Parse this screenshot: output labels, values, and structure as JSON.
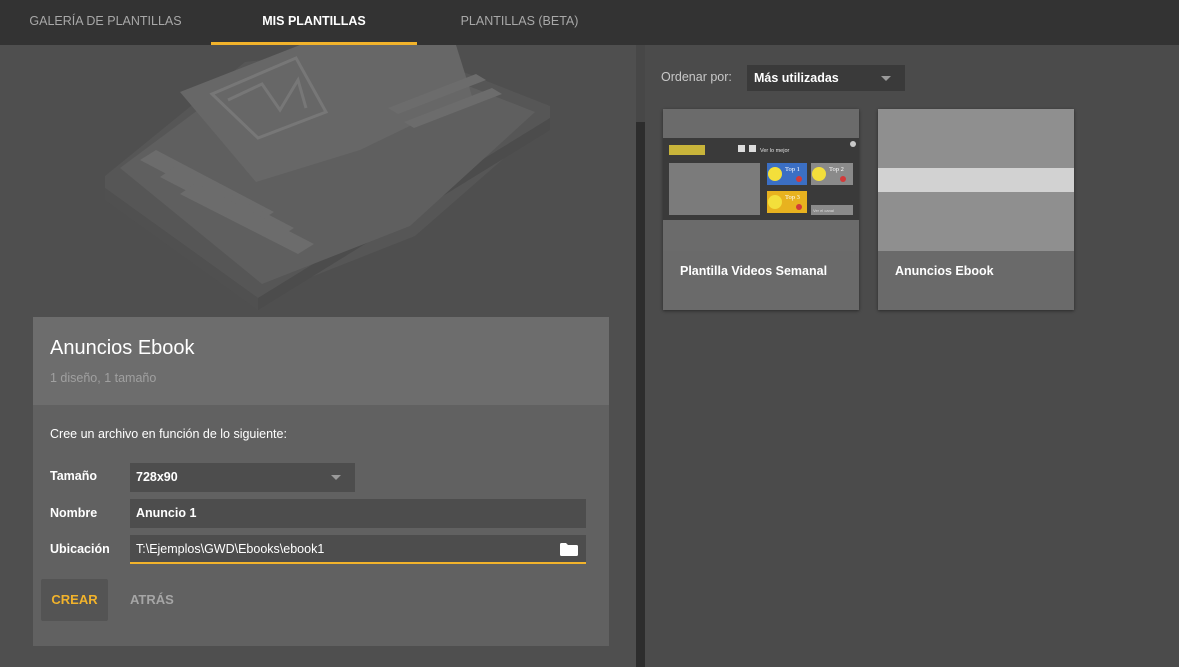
{
  "tabs": [
    {
      "label": "GALERÍA DE PLANTILLAS",
      "active": false
    },
    {
      "label": "MIS PLANTILLAS",
      "active": true
    },
    {
      "label": "PLANTILLAS (BETA)",
      "active": false
    }
  ],
  "selected_template": {
    "title": "Anuncios Ebook",
    "subtitle": "1 diseño, 1 tamaño",
    "instruction": "Cree un archivo en función de lo siguiente:",
    "size_label": "Tamaño",
    "size_value": "728x90",
    "name_label": "Nombre",
    "name_value": "Anuncio 1",
    "location_label": "Ubicación",
    "location_value": "T:\\Ejemplos\\GWD\\Ebooks\\ebook1",
    "create_label": "CREAR",
    "back_label": "ATRÁS"
  },
  "sort": {
    "label": "Ordenar por:",
    "value": "Más utilizadas"
  },
  "templates": [
    {
      "name": "Plantilla Videos Semanal",
      "preview_header": "Ver lo mejor",
      "preview_search": "Ver el canal",
      "preview_badges": [
        "Top 1",
        "Top 2",
        "Top 3"
      ]
    },
    {
      "name": "Anuncios Ebook"
    }
  ],
  "colors": {
    "accent": "#f2b32b",
    "topbar": "#333333",
    "card": "#616161"
  }
}
